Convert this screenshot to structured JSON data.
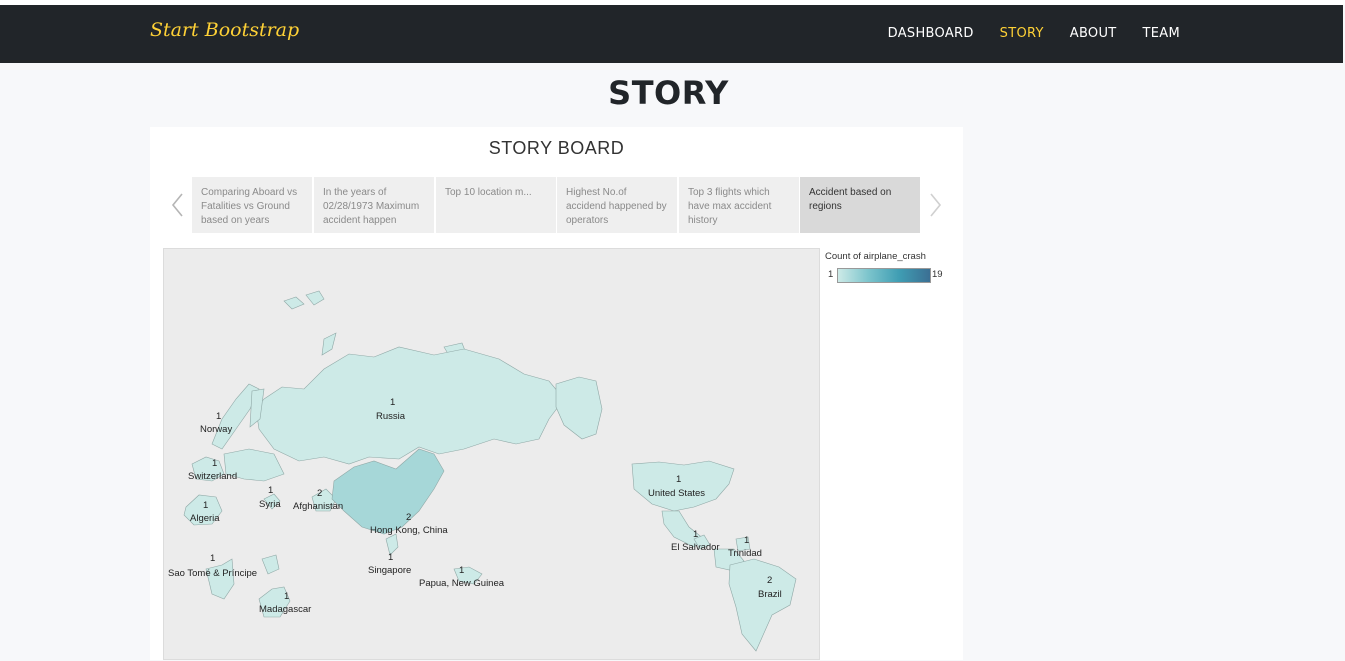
{
  "navbar": {
    "brand": "Start Bootstrap",
    "links": [
      {
        "label": "DASHBOARD"
      },
      {
        "label": "STORY"
      },
      {
        "label": "ABOUT"
      },
      {
        "label": "TEAM"
      }
    ],
    "active_color": "#fed136"
  },
  "page": {
    "title": "STORY"
  },
  "storyboard": {
    "title": "STORY BOARD",
    "tabs": [
      {
        "label": "Comparing Aboard vs Fatalities vs Ground based on years"
      },
      {
        "label": "In the years of 02/28/1973 Maximum accident happen"
      },
      {
        "label": "Top 10 location m..."
      },
      {
        "label": "Highest No.of accidend happened by operators"
      },
      {
        "label": "Top 3 flights which have max accident history"
      },
      {
        "label": "Accident based on regions"
      }
    ],
    "icons": {
      "prev": "chevron-left-icon",
      "next": "chevron-right-icon"
    }
  },
  "legend": {
    "title": "Count of airplane_crash",
    "min": "1",
    "max": "19"
  },
  "map": {
    "regions": [
      {
        "name": "Russia",
        "count": "1"
      },
      {
        "name": "Norway",
        "count": "1"
      },
      {
        "name": "Switzerland",
        "count": "1"
      },
      {
        "name": "Syria",
        "count": "1"
      },
      {
        "name": "Afghanistan",
        "count": "2"
      },
      {
        "name": "Algeria",
        "count": "1"
      },
      {
        "name": "Hong Kong, China",
        "count": "2"
      },
      {
        "name": "Sao Tomé & Príncipe",
        "count": "1"
      },
      {
        "name": "Singapore",
        "count": "1"
      },
      {
        "name": "Papua, New Guinea",
        "count": "1"
      },
      {
        "name": "Madagascar",
        "count": "1"
      },
      {
        "name": "United States",
        "count": "1"
      },
      {
        "name": "El Salvador",
        "count": "1"
      },
      {
        "name": "Trinidad",
        "count": "1"
      },
      {
        "name": "Brazil",
        "count": "2"
      }
    ],
    "colors": {
      "low": "#cdeae7",
      "mid": "#a9d9d9",
      "ocean": "#ececec"
    }
  }
}
